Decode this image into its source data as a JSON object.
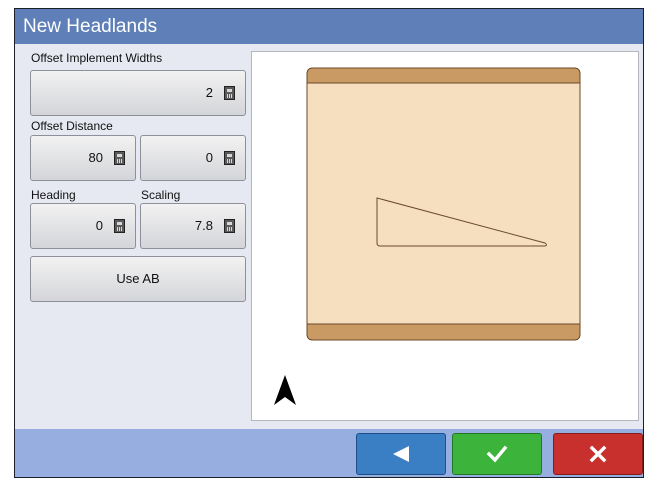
{
  "window": {
    "title": "New Headlands"
  },
  "fields": {
    "offset_widths_label": "Offset Implement Widths",
    "offset_widths_value": "2",
    "offset_distance_label": "Offset Distance",
    "offset_distance_value_1": "80",
    "offset_distance_value_2": "0",
    "heading_label": "Heading",
    "heading_value": "0",
    "scaling_label": "Scaling",
    "scaling_value": "7.8",
    "use_ab_label": "Use AB"
  },
  "footer": {
    "back_icon": "triangle-left-icon",
    "accept_icon": "check-icon",
    "cancel_icon": "x-icon"
  },
  "colors": {
    "title_bar": "#5e7fb7",
    "back": "#3a7ec4",
    "accept": "#3cb43c",
    "cancel": "#c8302e",
    "field_fill": "#f5dfbf",
    "headland_fill": "#c99a64"
  }
}
